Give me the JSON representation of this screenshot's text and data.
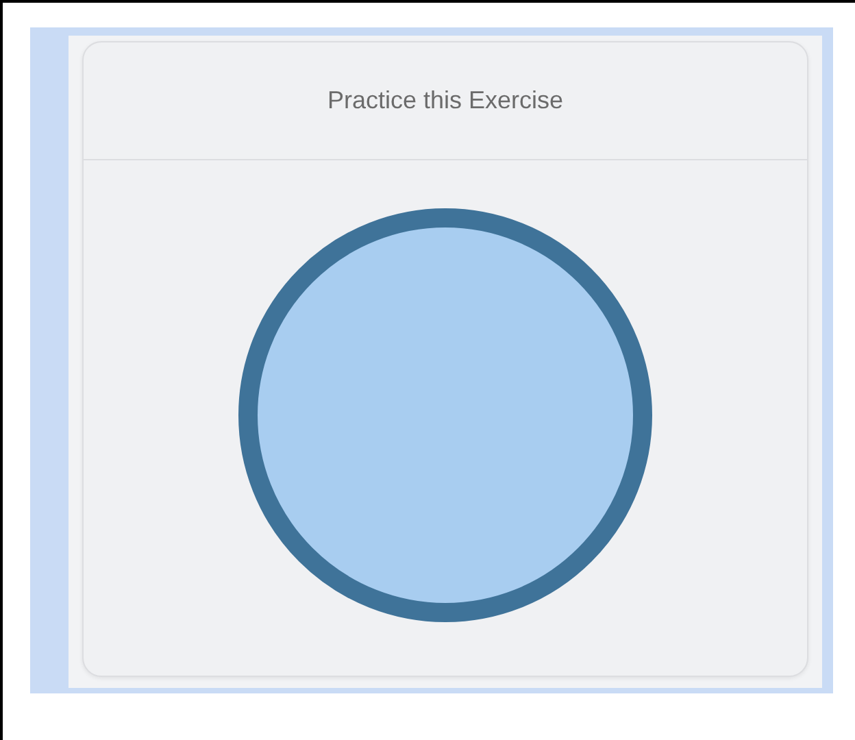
{
  "card": {
    "title": "Practice this Exercise"
  }
}
